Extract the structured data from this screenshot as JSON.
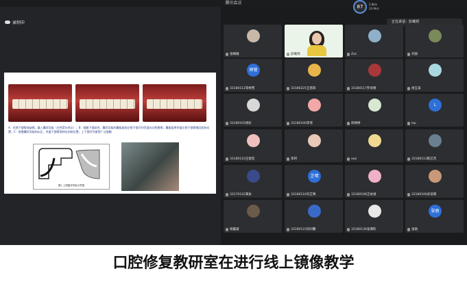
{
  "window": {
    "title": "腾讯会议"
  },
  "share": {
    "recording_label": "录制中",
    "slide": {
      "caption": "A：右侧下颌骨体缺损，戴入翼状导板（白色箭头所示）；B：随着下颌闭合，翼状导板的翼板紧贴左侧下颌牙列舌面向口腔唇侧，翼板阻将余留左侧下颌骨推回初始位置；C：依靠翼状导板的纠正，余留下颌骨保持在初始位置，上下颌牙列紧密广泛接触",
      "figure_caption": "图2 上颌翼状导板示意图"
    }
  },
  "network": {
    "value": "87",
    "upload": "2.8k/s",
    "download": "33.9k/s"
  },
  "speaking": {
    "label": "正在讲话：彭曦玥"
  },
  "participants": [
    {
      "name": "张桐珊",
      "avatar": "photo",
      "color": "#c9b8a8"
    },
    {
      "name": "彭曦玥",
      "avatar": "video",
      "color": "#eaf4e8"
    },
    {
      "name": "Zzz",
      "avatar": "photo",
      "color": "#8fb0c9"
    },
    {
      "name": "刘丽",
      "avatar": "photo",
      "color": "#7a8a5a"
    },
    {
      "name": "33180112李婷营",
      "avatar": "text",
      "text": "婷营",
      "color": "#2f6fd8"
    },
    {
      "name": "33180225王悠阳",
      "avatar": "photo",
      "color": "#e8b54a"
    },
    {
      "name": "33180117罗语晴",
      "avatar": "photo",
      "color": "#a8383a"
    },
    {
      "name": "谢玉溪",
      "avatar": "photo",
      "color": "#a9d8e0"
    },
    {
      "name": "33180101杨彩",
      "avatar": "photo",
      "color": "#d8d8d8"
    },
    {
      "name": "33180100李瑶",
      "avatar": "photo",
      "color": "#f2a8a8"
    },
    {
      "name": "邱婷婷",
      "avatar": "photo",
      "color": "#d8e8d0"
    },
    {
      "name": "lxp",
      "avatar": "text",
      "text": "L",
      "color": "#2f6fd8"
    },
    {
      "name": "33180110王紫晗",
      "avatar": "photo",
      "color": "#f0c0c0"
    },
    {
      "name": "李珂",
      "avatar": "photo",
      "color": "#e8c8b8"
    },
    {
      "name": "ooo",
      "avatar": "photo",
      "color": "#f0d890"
    },
    {
      "name": "33180113陈芯芃",
      "avatar": "photo",
      "color": "#6a7f90"
    },
    {
      "name": "3317011E黄玫",
      "avatar": "photo",
      "color": "#3a4a8a"
    },
    {
      "name": "33180116刘芷晴",
      "avatar": "text",
      "text": "芷晴",
      "color": "#2f6fd8"
    },
    {
      "name": "33180108王依涵",
      "avatar": "photo",
      "color": "#f0b0c8"
    },
    {
      "name": "33180106武语萌",
      "avatar": "photo",
      "color": "#c89878"
    },
    {
      "name": "杨露凝",
      "avatar": "photo",
      "color": "#6a5a4a"
    },
    {
      "name": "33180123刘同馨",
      "avatar": "photo",
      "color": "#3a6ac8"
    },
    {
      "name": "33180130张谭钦",
      "avatar": "photo",
      "color": "#e8e8e8"
    },
    {
      "name": "张驰",
      "avatar": "text",
      "text": "张驰",
      "color": "#2f6fd8"
    }
  ],
  "bottom_title": "口腔修复教研室在进行线上镜像教学"
}
